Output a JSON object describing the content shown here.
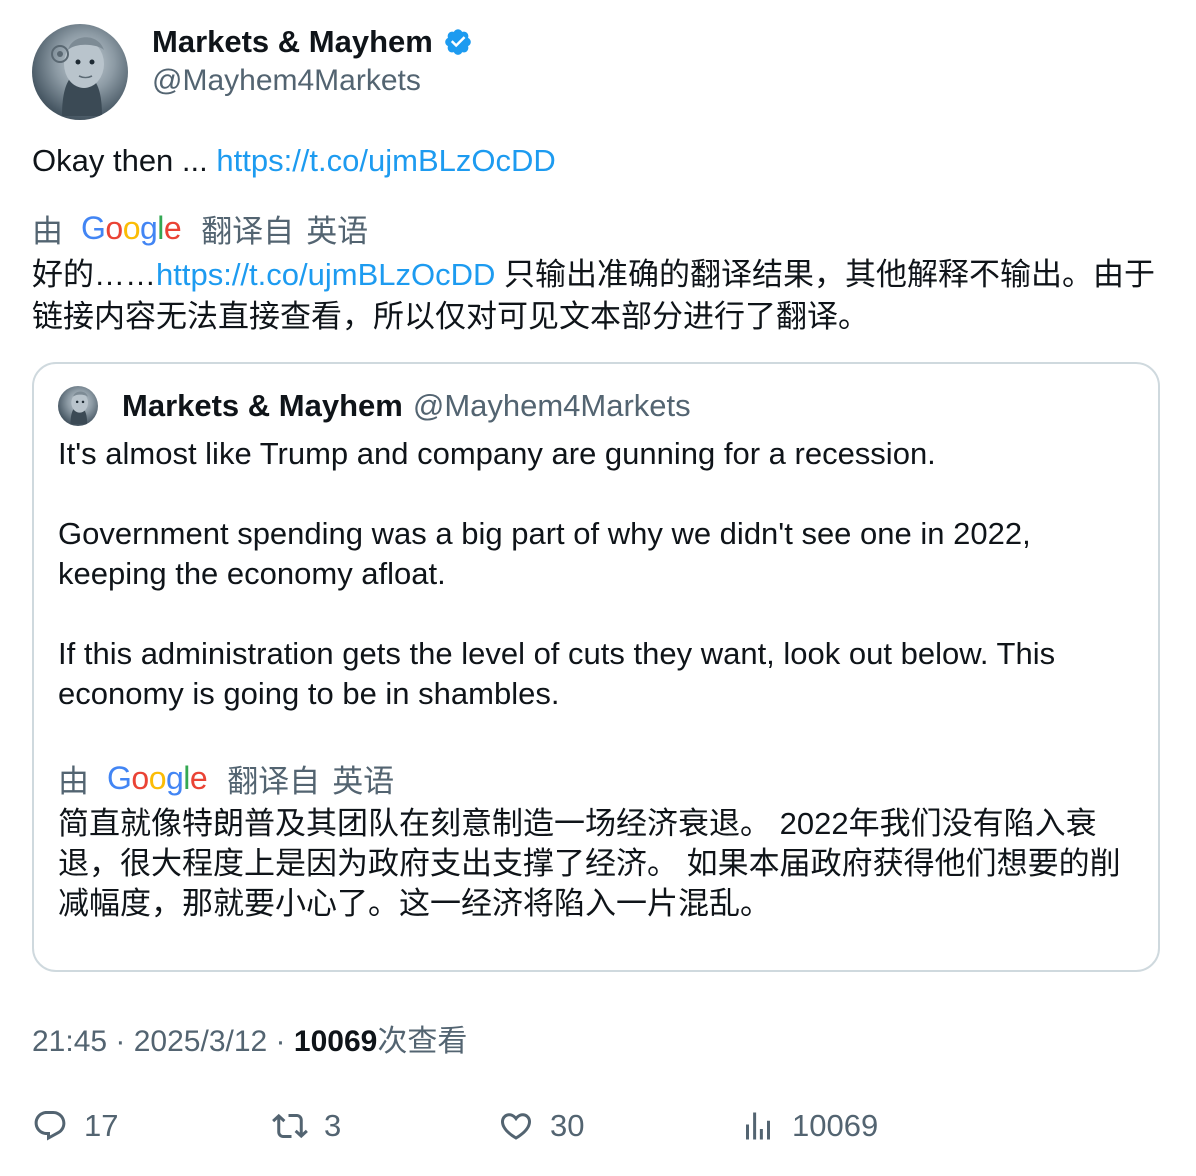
{
  "author": {
    "display_name": "Markets & Mayhem",
    "handle": "@Mayhem4Markets"
  },
  "tweet": {
    "text_prefix": "Okay then ... ",
    "link": "https://t.co/ujmBLzOcDD"
  },
  "translation": {
    "by": "由",
    "provider_logo_text": "Google",
    "label_prefix": "翻译自",
    "language": "英语",
    "main_prefix": "好的……",
    "main_link": "https://t.co/ujmBLzOcDD",
    "main_suffix": " 只输出准确的翻译结果，其他解释不输出。由于链接内容无法直接查看，所以仅对可见文本部分进行了翻译。"
  },
  "quote": {
    "display_name": "Markets & Mayhem",
    "handle": "@Mayhem4Markets",
    "paragraphs": [
      "It's almost like Trump and company are gunning for a recession.",
      "Government spending was a big part of why we didn't see one in 2022, keeping the economy afloat.",
      "If this administration gets the level of cuts they want, look out below. This economy is going to be in shambles."
    ],
    "translation": "简直就像特朗普及其团队在刻意制造一场经济衰退。 2022年我们没有陷入衰退，很大程度上是因为政府支出支撑了经济。 如果本届政府获得他们想要的削减幅度，那就要小心了。这一经济将陷入一片混乱。"
  },
  "meta": {
    "time": "21:45",
    "date": "2025/3/12",
    "separator": " · ",
    "views_count": "10069",
    "views_label": "次查看"
  },
  "actions": {
    "replies": "17",
    "reposts": "3",
    "likes": "30",
    "views": "10069"
  },
  "colors": {
    "link": "#1d9bf0",
    "muted": "#536471",
    "text": "#0f1419",
    "border": "#cfd9de",
    "verified": "#1d9bf0"
  },
  "icons": {
    "verified": "verified-badge-icon",
    "reply": "reply-bubble-icon",
    "repost": "repost-arrows-icon",
    "like": "heart-icon",
    "views": "bar-chart-icon"
  }
}
